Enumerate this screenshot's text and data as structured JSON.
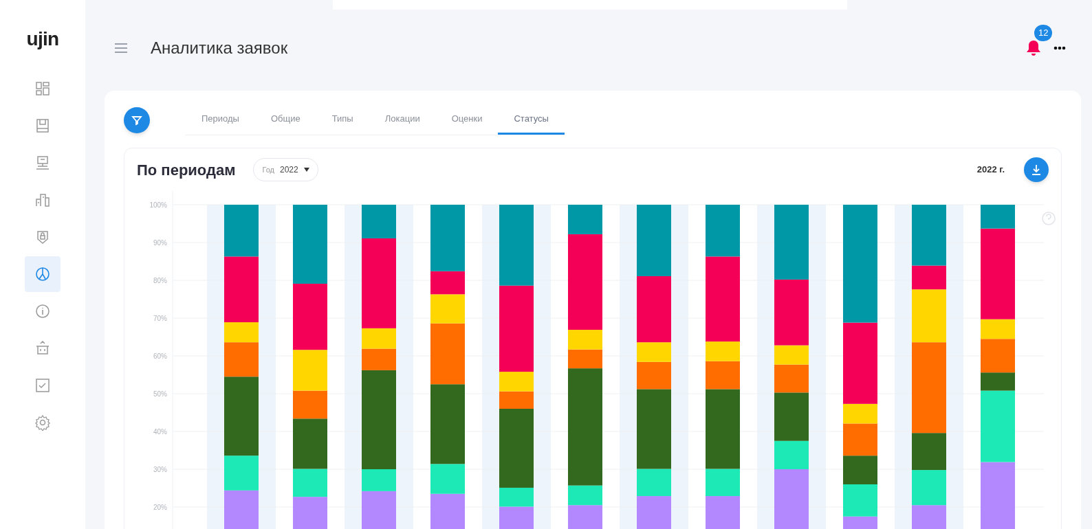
{
  "logo": "ujin",
  "sidebar": {
    "items": [
      {
        "selected": false
      },
      {
        "selected": false
      },
      {
        "selected": false
      },
      {
        "selected": false
      },
      {
        "selected": false
      },
      {
        "selected": true
      },
      {
        "selected": false
      },
      {
        "selected": false
      },
      {
        "selected": false
      },
      {
        "selected": false
      }
    ]
  },
  "header": {
    "title": "Аналитика заявок",
    "notifications": "12"
  },
  "tabs": [
    {
      "label": "Периоды",
      "selected": false
    },
    {
      "label": "Общие",
      "selected": false
    },
    {
      "label": "Типы",
      "selected": false
    },
    {
      "label": "Локации",
      "selected": false
    },
    {
      "label": "Оценки",
      "selected": false
    },
    {
      "label": "Статусы",
      "selected": true
    }
  ],
  "card": {
    "title": "По периодам",
    "select": {
      "label": "Год",
      "value": "2022"
    },
    "period": "2022 г.",
    "chart_data": {
      "type": "bar",
      "stacked": true,
      "grid": true,
      "ylim": [
        0,
        100
      ],
      "yticks": [
        {
          "value": 20,
          "label": "20%"
        },
        {
          "value": 30,
          "label": "30%"
        },
        {
          "value": 40,
          "label": "40%"
        },
        {
          "value": 50,
          "label": "50%"
        },
        {
          "value": 60,
          "label": "60%"
        },
        {
          "value": 70,
          "label": "70%"
        },
        {
          "value": 80,
          "label": "80%"
        },
        {
          "value": 90,
          "label": "90%"
        },
        {
          "value": 100,
          "label": "100%"
        }
      ],
      "series": [
        {
          "color": "#b388ff",
          "values": [
            24.4,
            22.7,
            24.2,
            23.5,
            20.1,
            20.5,
            22.9,
            22.9,
            30.0,
            17.5,
            20.5,
            31.9
          ]
        },
        {
          "color": "#1de9b6",
          "values": [
            9.2,
            7.4,
            5.8,
            7.9,
            5.0,
            5.2,
            7.2,
            7.2,
            7.5,
            8.5,
            9.3,
            18.9
          ]
        },
        {
          "color": "#33691e",
          "values": [
            20.9,
            13.3,
            26.2,
            21.1,
            20.9,
            31.0,
            21.1,
            21.1,
            12.8,
            7.6,
            9.8,
            4.8
          ]
        },
        {
          "color": "#ff6d00",
          "values": [
            9.1,
            7.4,
            5.7,
            16.1,
            4.6,
            5.0,
            7.2,
            7.4,
            7.4,
            8.5,
            24.0,
            8.9
          ]
        },
        {
          "color": "#ffd600",
          "values": [
            5.3,
            10.8,
            5.4,
            7.7,
            5.2,
            5.2,
            5.2,
            5.2,
            5.1,
            5.2,
            14.0,
            5.2
          ]
        },
        {
          "color": "#f50057",
          "values": [
            17.4,
            17.5,
            23.8,
            6.1,
            22.8,
            25.3,
            17.5,
            22.5,
            17.4,
            21.5,
            6.3,
            24.0
          ]
        },
        {
          "color": "#0097a7",
          "values": [
            13.7,
            20.9,
            8.9,
            17.6,
            21.4,
            7.8,
            18.9,
            13.7,
            19.8,
            31.2,
            16.1,
            6.3
          ]
        }
      ]
    }
  }
}
